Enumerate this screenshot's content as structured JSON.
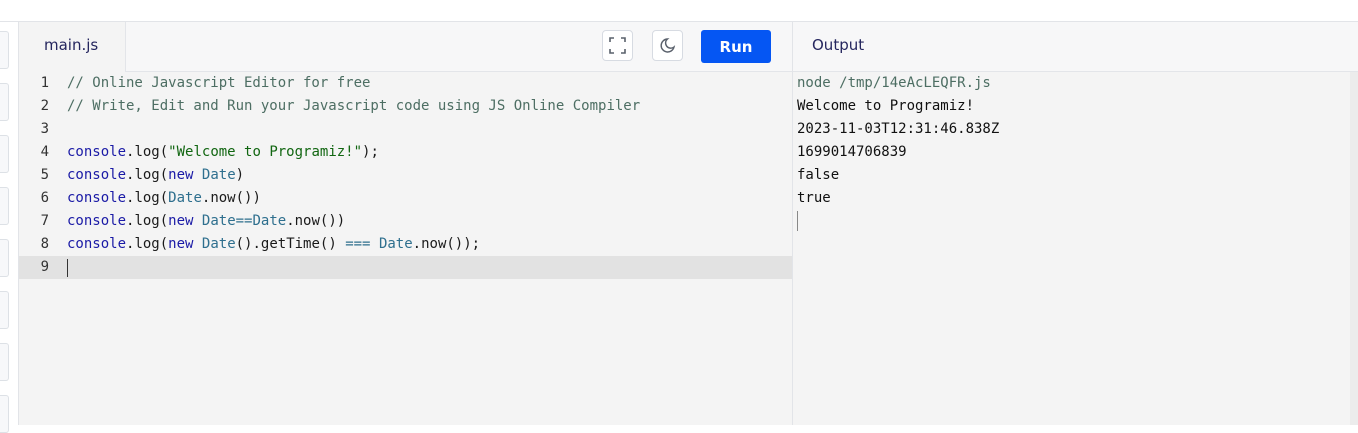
{
  "editor": {
    "file_tab": "main.js",
    "run_label": "Run",
    "icons": {
      "fullscreen": "fullscreen-icon",
      "theme": "moon-icon"
    },
    "lines": [
      {
        "num": "1",
        "tokens": [
          {
            "t": "// Online Javascript Editor for free",
            "c": "comment"
          }
        ]
      },
      {
        "num": "2",
        "tokens": [
          {
            "t": "// Write, Edit and Run your Javascript code using JS Online Compiler",
            "c": "comment"
          }
        ]
      },
      {
        "num": "3",
        "tokens": []
      },
      {
        "num": "4",
        "tokens": [
          {
            "t": "console",
            "c": "kw"
          },
          {
            "t": ".log(",
            "c": ""
          },
          {
            "t": "\"Welcome to Programiz!\"",
            "c": "str"
          },
          {
            "t": ");",
            "c": ""
          }
        ]
      },
      {
        "num": "5",
        "tokens": [
          {
            "t": "console",
            "c": "kw"
          },
          {
            "t": ".log(",
            "c": ""
          },
          {
            "t": "new",
            "c": "kw"
          },
          {
            "t": " ",
            "c": ""
          },
          {
            "t": "Date",
            "c": "type"
          },
          {
            "t": ")",
            "c": ""
          }
        ]
      },
      {
        "num": "6",
        "tokens": [
          {
            "t": "console",
            "c": "kw"
          },
          {
            "t": ".log(",
            "c": ""
          },
          {
            "t": "Date",
            "c": "type"
          },
          {
            "t": ".now())",
            "c": ""
          }
        ]
      },
      {
        "num": "7",
        "tokens": [
          {
            "t": "console",
            "c": "kw"
          },
          {
            "t": ".log(",
            "c": ""
          },
          {
            "t": "new",
            "c": "kw"
          },
          {
            "t": " ",
            "c": ""
          },
          {
            "t": "Date",
            "c": "type"
          },
          {
            "t": "==",
            "c": "type"
          },
          {
            "t": "Date",
            "c": "type"
          },
          {
            "t": ".now())",
            "c": ""
          }
        ]
      },
      {
        "num": "8",
        "tokens": [
          {
            "t": "console",
            "c": "kw"
          },
          {
            "t": ".log(",
            "c": ""
          },
          {
            "t": "new",
            "c": "kw"
          },
          {
            "t": " ",
            "c": ""
          },
          {
            "t": "Date",
            "c": "type"
          },
          {
            "t": "().getTime() ",
            "c": ""
          },
          {
            "t": "===",
            "c": "type"
          },
          {
            "t": " ",
            "c": ""
          },
          {
            "t": "Date",
            "c": "type"
          },
          {
            "t": ".now());",
            "c": ""
          }
        ]
      },
      {
        "num": "9",
        "tokens": [],
        "active": true
      }
    ]
  },
  "output": {
    "title": "Output",
    "command": "node /tmp/14eAcLEQFR.js",
    "lines": [
      "Welcome to Programiz!",
      "2023-11-03T12:31:46.838Z",
      "1699014706839",
      "false",
      "true"
    ]
  },
  "colors": {
    "run_button": "#0556f3",
    "comment": "#4d6e63",
    "keyword": "#1a1aa6",
    "string": "#116611",
    "type": "#2e6f8e"
  }
}
